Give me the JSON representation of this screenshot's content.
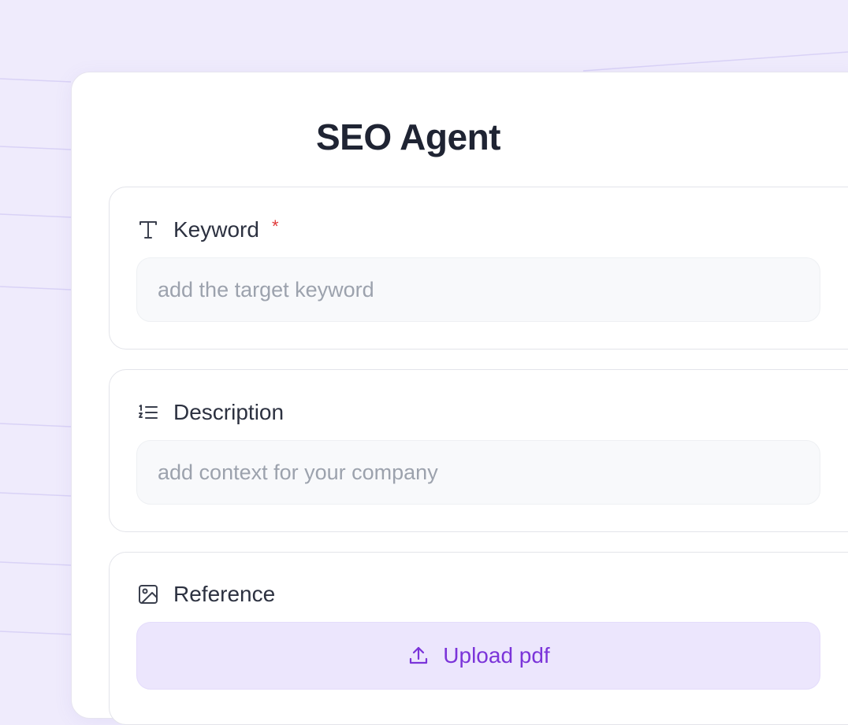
{
  "form": {
    "title": "SEO Agent",
    "fields": {
      "keyword": {
        "label": "Keyword",
        "required_marker": "*",
        "placeholder": "add the target keyword",
        "value": "",
        "icon": "text-icon"
      },
      "description": {
        "label": "Description",
        "placeholder": "add context for your company",
        "value": "",
        "icon": "list-icon"
      },
      "reference": {
        "label": "Reference",
        "icon": "image-icon",
        "upload_label": "Upload pdf",
        "upload_icon": "upload-icon"
      }
    }
  },
  "colors": {
    "background": "#efebfc",
    "card": "#ffffff",
    "title_text": "#1f2433",
    "required": "#e03a3a",
    "upload_accent": "#7b34d9",
    "upload_bg": "#ece6fd",
    "input_bg": "#f8f9fb",
    "placeholder": "#9ca2ad"
  }
}
